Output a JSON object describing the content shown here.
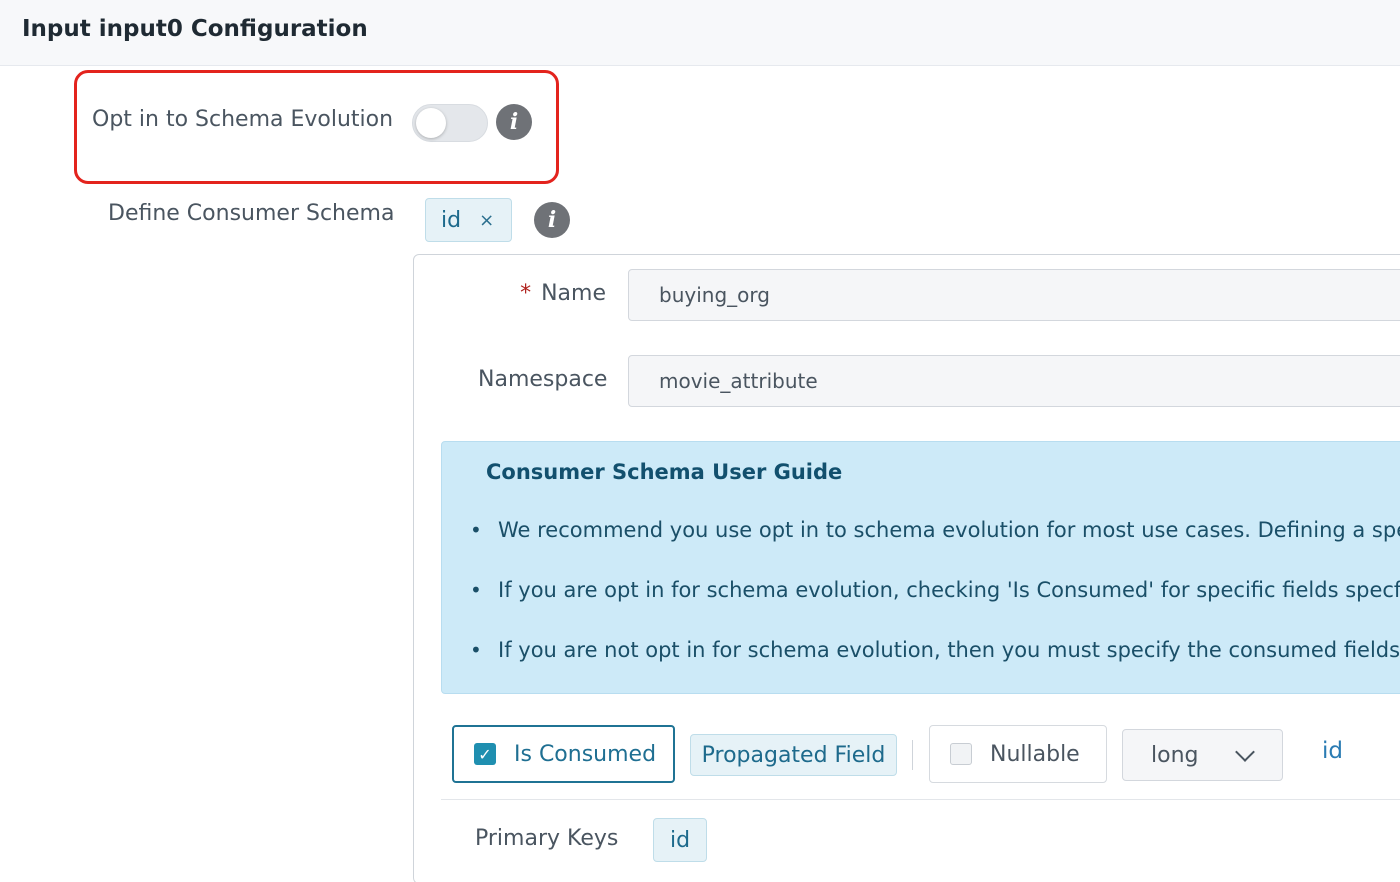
{
  "header": {
    "title": "Input input0 Configuration"
  },
  "schema_evolution": {
    "label": "Opt in to Schema Evolution",
    "enabled": false,
    "info_icon": "info-icon"
  },
  "consumer_schema": {
    "label": "Define Consumer Schema",
    "tag": "id",
    "tag_close": "×",
    "info_icon": "info-icon"
  },
  "form": {
    "name_required_mark": "*",
    "name_label": "Name",
    "name_value": "buying_org",
    "namespace_label": "Namespace",
    "namespace_value": "movie_attribute"
  },
  "guide": {
    "title": "Consumer Schema User Guide",
    "items": [
      "We recommend you use opt in to schema evolution for most use cases. Defining a specific",
      "If you are opt in for schema evolution, checking 'Is Consumed' for specific fields specfies t",
      "If you are not opt in for schema evolution, then you must specify the consumed fields that"
    ]
  },
  "field_row": {
    "is_consumed_label": "Is Consumed",
    "is_consumed_checked": true,
    "propagated_label": "Propagated Field",
    "nullable_label": "Nullable",
    "nullable_checked": false,
    "type_value": "long",
    "field_name": "id"
  },
  "primary_keys": {
    "label": "Primary Keys",
    "tag": "id"
  },
  "colors": {
    "highlight": "#e3231d",
    "accent": "#1f7394",
    "guide_bg": "#cdeaf8"
  }
}
